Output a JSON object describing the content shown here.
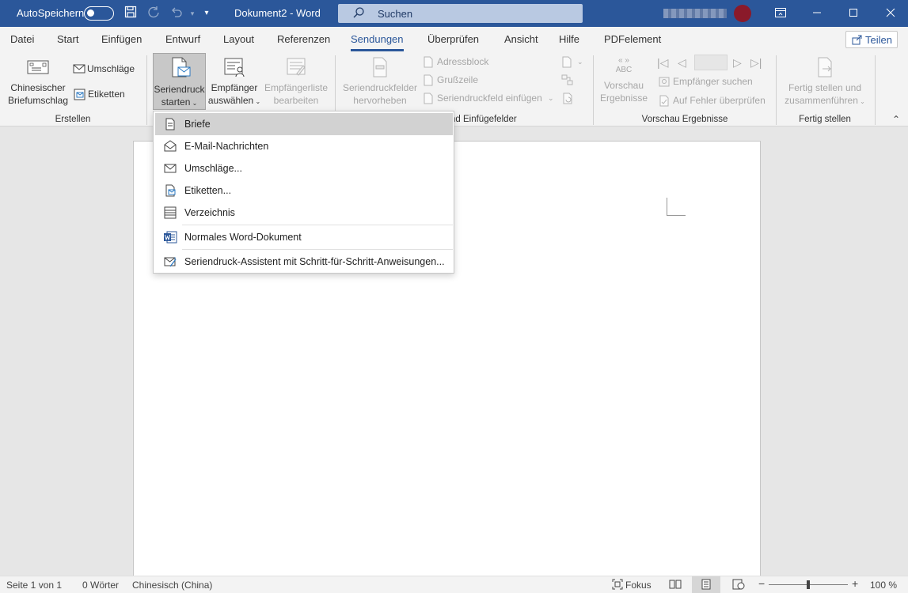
{
  "titlebar": {
    "autosave_label": "AutoSpeichern",
    "doc_title": "Dokument2  -  Word",
    "search_label": "Suchen",
    "icons": [
      "save-icon",
      "redo-icon",
      "undo-icon",
      "qat-dropdown-icon",
      "ribbon-display-icon",
      "minimize-icon",
      "maximize-icon",
      "close-icon"
    ]
  },
  "tabs": [
    {
      "label": "Datei"
    },
    {
      "label": "Start"
    },
    {
      "label": "Einfügen"
    },
    {
      "label": "Entwurf"
    },
    {
      "label": "Layout"
    },
    {
      "label": "Referenzen"
    },
    {
      "label": "Sendungen",
      "active": true
    },
    {
      "label": "Überprüfen"
    },
    {
      "label": "Ansicht"
    },
    {
      "label": "Hilfe"
    },
    {
      "label": "PDFelement"
    }
  ],
  "share_label": "Teilen",
  "ribbon": {
    "erstellen": {
      "label": "Erstellen",
      "chinese_line1": "Chinesischer",
      "chinese_line2": "Briefumschlag",
      "envelopes": "Umschläge",
      "labels": "Etiketten"
    },
    "start": {
      "mailmerge_line1": "Seriendruck",
      "mailmerge_line2": "starten",
      "recipients_line1": "Empfänger",
      "recipients_line2": "auswählen",
      "edit_list_line1": "Empfängerliste",
      "edit_list_line2": "bearbeiten"
    },
    "fields": {
      "label": "nd Einfügefelder",
      "highlight_line1": "Seriendruckfelder",
      "highlight_line2": "hervorheben",
      "address_block": "Adressblock",
      "greeting": "Grußzeile",
      "insert_field": "Seriendruckfeld einfügen"
    },
    "preview": {
      "label": "Vorschau Ergebnisse",
      "preview_line1": "Vorschau",
      "preview_line2": "Ergebnisse",
      "abc": "ABC",
      "find_recipient": "Empfänger suchen",
      "check_errors": "Auf Fehler überprüfen"
    },
    "finish": {
      "label": "Fertig stellen",
      "finish_line1": "Fertig stellen und",
      "finish_line2": "zusammenführen"
    }
  },
  "menu": {
    "items": [
      {
        "label": "Briefe",
        "icon": "letter-icon"
      },
      {
        "label": "E-Mail-Nachrichten",
        "icon": "email-icon"
      },
      {
        "label": "Umschläge...",
        "icon": "envelope-icon"
      },
      {
        "label": "Etiketten...",
        "icon": "labels-icon"
      },
      {
        "label": "Verzeichnis",
        "icon": "directory-icon"
      },
      {
        "label": "Normales Word-Dokument",
        "icon": "word-document-icon"
      },
      {
        "label": "Seriendruck-Assistent mit Schritt-für-Schritt-Anweisungen...",
        "icon": "wizard-icon"
      }
    ]
  },
  "status": {
    "page": "Seite 1 von 1",
    "words": "0 Wörter",
    "language": "Chinesisch (China)",
    "focus": "Fokus",
    "zoom": "100 %",
    "zoom_fraction": 0.5
  },
  "colors": {
    "brand": "#2b579a",
    "ribbon_bg": "#f3f3f3",
    "canvas_bg": "#e6e6e6",
    "menu_hover": "#d2d2d2"
  }
}
